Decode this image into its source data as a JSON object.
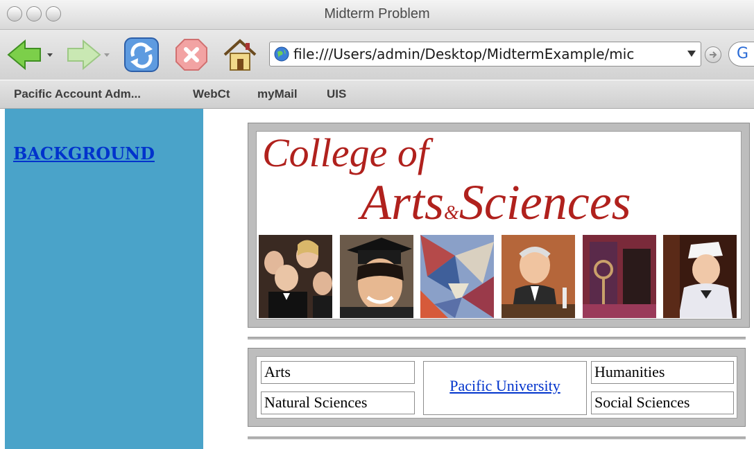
{
  "window": {
    "title": "Midterm Problem"
  },
  "toolbar": {
    "icons": [
      "back-arrow-icon",
      "forward-arrow-icon",
      "reload-icon",
      "stop-icon",
      "home-icon"
    ],
    "address": "file:///Users/admin/Desktop/MidtermExample/mic",
    "search_letter": "G"
  },
  "bookmarks": [
    "Pacific Account Adm...",
    "WebCt",
    "myMail",
    "UIS"
  ],
  "sidebar": {
    "link": "BACKGROUND",
    "color": "#4aa3c9"
  },
  "banner": {
    "line1": "College of",
    "line2_a": "Arts",
    "line2_amp": "&",
    "line2_b": "Sciences",
    "color": "#b0211d"
  },
  "nav": {
    "left": [
      "Arts",
      "Natural Sciences"
    ],
    "center": "Pacific University",
    "right": [
      "Humanities",
      "Social Sciences"
    ]
  }
}
